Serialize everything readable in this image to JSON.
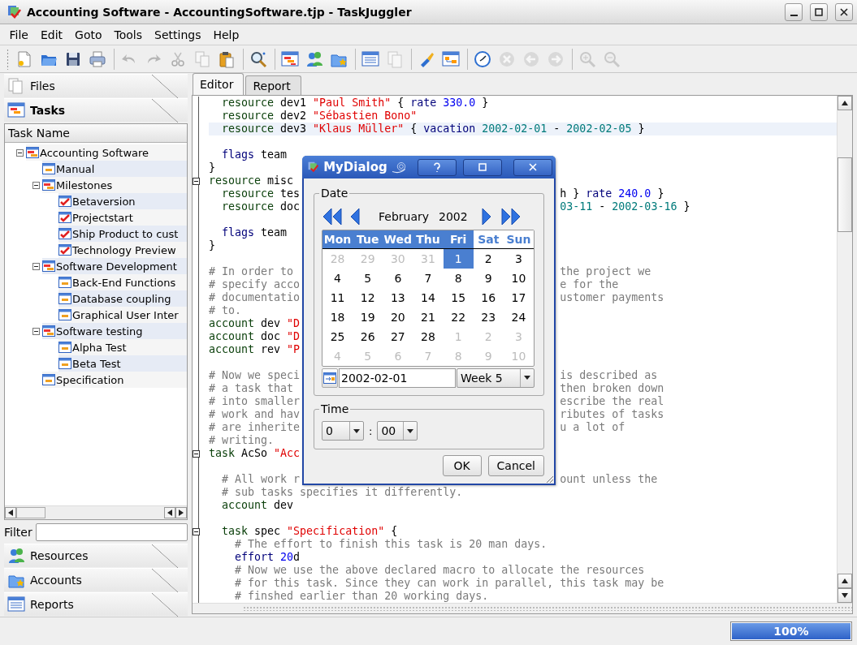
{
  "window": {
    "title": "Accounting Software - AccountingSoftware.tjp - TaskJuggler"
  },
  "menu": [
    "File",
    "Edit",
    "Goto",
    "Tools",
    "Settings",
    "Help"
  ],
  "toolbar": [
    [
      {
        "disabled": false
      },
      {
        "disabled": false
      },
      {
        "disabled": false
      },
      {
        "disabled": false
      }
    ],
    [
      {
        "disabled": true
      },
      {
        "disabled": true
      },
      {
        "disabled": true
      },
      {
        "disabled": true
      },
      {
        "disabled": false
      }
    ],
    [
      {
        "disabled": false
      }
    ],
    [
      {
        "disabled": false
      },
      {
        "disabled": false
      },
      {
        "disabled": false
      }
    ],
    [
      {
        "disabled": false
      },
      {
        "disabled": true
      }
    ],
    [
      {
        "disabled": false
      },
      {
        "disabled": false
      }
    ],
    [
      {
        "disabled": false
      },
      {
        "disabled": true
      },
      {
        "disabled": true
      },
      {
        "disabled": true
      }
    ],
    [
      {
        "disabled": true
      },
      {
        "disabled": true
      }
    ]
  ],
  "sidebar": {
    "sections": [
      {
        "label": "Files",
        "selected": false
      },
      {
        "label": "Tasks",
        "selected": true
      },
      {
        "label": "Resources",
        "selected": false
      },
      {
        "label": "Accounts",
        "selected": false
      },
      {
        "label": "Reports",
        "selected": false
      }
    ],
    "tree": {
      "column": "Task Name",
      "items": [
        {
          "label": "Accounting Software",
          "kind": "group",
          "expanded": true,
          "children": [
            {
              "label": "Manual",
              "kind": "task"
            },
            {
              "label": "Milestones",
              "kind": "group",
              "expanded": true,
              "children": [
                {
                  "label": "Betaversion",
                  "kind": "milestone"
                },
                {
                  "label": "Projectstart",
                  "kind": "milestone"
                },
                {
                  "label": "Ship Product to cust",
                  "kind": "milestone"
                },
                {
                  "label": "Technology Preview",
                  "kind": "milestone"
                }
              ]
            },
            {
              "label": "Software Development",
              "kind": "group",
              "expanded": true,
              "children": [
                {
                  "label": "Back-End Functions",
                  "kind": "task"
                },
                {
                  "label": "Database coupling",
                  "kind": "task"
                },
                {
                  "label": "Graphical User Inter",
                  "kind": "task"
                }
              ]
            },
            {
              "label": "Software testing",
              "kind": "group",
              "expanded": true,
              "children": [
                {
                  "label": "Alpha Test",
                  "kind": "task"
                },
                {
                  "label": "Beta Test",
                  "kind": "task"
                }
              ]
            },
            {
              "label": "Specification",
              "kind": "task"
            }
          ]
        }
      ]
    },
    "filter": {
      "label": "Filter"
    }
  },
  "editor": {
    "tabs": [
      {
        "label": "Editor",
        "selected": true
      },
      {
        "label": "Report",
        "selected": false
      }
    ],
    "lines": [
      {
        "kind": "code",
        "left": [
          {
            "kind": "kw",
            "text": "  resource"
          },
          {
            "kind": "p",
            "text": " dev1 "
          },
          {
            "kind": "s",
            "text": "\"Paul Smith\""
          },
          {
            "kind": "p",
            "text": " { "
          },
          {
            "kind": "k2",
            "text": "rate"
          },
          {
            "kind": "n",
            "text": " 330.0"
          },
          {
            "kind": "p",
            "text": " }"
          }
        ]
      },
      {
        "kind": "code",
        "left": [
          {
            "kind": "kw",
            "text": "  resource"
          },
          {
            "kind": "p",
            "text": " dev2 "
          },
          {
            "kind": "s",
            "text": "\"Sébastien Bono\""
          }
        ]
      },
      {
        "kind": "code",
        "current": true,
        "left": [
          {
            "kind": "kw",
            "text": "  resource"
          },
          {
            "kind": "p",
            "text": " dev3 "
          },
          {
            "kind": "s",
            "text": "\"Klaus Müller\""
          },
          {
            "kind": "p",
            "text": " { "
          },
          {
            "kind": "k2",
            "text": "vacation"
          },
          {
            "kind": "d",
            "text": " 2002-02-01"
          },
          {
            "kind": "p",
            "text": " - "
          },
          {
            "kind": "d",
            "text": "2002-02-05"
          },
          {
            "kind": "p",
            "text": " }"
          }
        ]
      },
      {
        "kind": "blank"
      },
      {
        "kind": "code",
        "left": [
          {
            "kind": "k2",
            "text": "  flags"
          },
          {
            "kind": "p",
            "text": " team"
          }
        ]
      },
      {
        "kind": "code",
        "left": [
          {
            "kind": "p",
            "text": "}"
          }
        ]
      },
      {
        "kind": "code",
        "fold": true,
        "left": [
          {
            "kind": "kw",
            "text": "resource"
          },
          {
            "kind": "p",
            "text": " misc"
          }
        ]
      },
      {
        "kind": "code",
        "left": [
          {
            "kind": "kw",
            "text": "  resource"
          },
          {
            "kind": "p",
            "text": " tes"
          }
        ],
        "right": [
          {
            "kind": "p",
            "text": "h } "
          },
          {
            "kind": "k2",
            "text": "rate"
          },
          {
            "kind": "n",
            "text": " 240.0"
          },
          {
            "kind": "p",
            "text": " }"
          }
        ]
      },
      {
        "kind": "code",
        "left": [
          {
            "kind": "kw",
            "text": "  resource"
          },
          {
            "kind": "p",
            "text": " doc"
          }
        ],
        "right": [
          {
            "kind": "d",
            "text": "03-11"
          },
          {
            "kind": "p",
            "text": " - "
          },
          {
            "kind": "d",
            "text": "2002-03-16"
          },
          {
            "kind": "p",
            "text": " }"
          }
        ]
      },
      {
        "kind": "blank"
      },
      {
        "kind": "code",
        "left": [
          {
            "kind": "k2",
            "text": "  flags"
          },
          {
            "kind": "p",
            "text": " team"
          }
        ]
      },
      {
        "kind": "code",
        "left": [
          {
            "kind": "p",
            "text": "}"
          }
        ]
      },
      {
        "kind": "blank"
      },
      {
        "kind": "code",
        "left": [
          {
            "kind": "c",
            "text": "# In order to"
          }
        ],
        "right": [
          {
            "kind": "c",
            "text": "the project we"
          }
        ]
      },
      {
        "kind": "code",
        "left": [
          {
            "kind": "c",
            "text": "# specify acco"
          }
        ],
        "right": [
          {
            "kind": "c",
            "text": "e for the"
          }
        ]
      },
      {
        "kind": "code",
        "left": [
          {
            "kind": "c",
            "text": "# documentatio"
          }
        ],
        "right": [
          {
            "kind": "c",
            "text": "ustomer payments"
          }
        ]
      },
      {
        "kind": "code",
        "left": [
          {
            "kind": "c",
            "text": "# to."
          }
        ]
      },
      {
        "kind": "code",
        "left": [
          {
            "kind": "kw",
            "text": "account"
          },
          {
            "kind": "p",
            "text": " dev "
          },
          {
            "kind": "s",
            "text": "\"D"
          }
        ]
      },
      {
        "kind": "code",
        "left": [
          {
            "kind": "kw",
            "text": "account"
          },
          {
            "kind": "p",
            "text": " doc "
          },
          {
            "kind": "s",
            "text": "\"D"
          }
        ]
      },
      {
        "kind": "code",
        "left": [
          {
            "kind": "kw",
            "text": "account"
          },
          {
            "kind": "p",
            "text": " rev "
          },
          {
            "kind": "s",
            "text": "\"P"
          }
        ]
      },
      {
        "kind": "blank"
      },
      {
        "kind": "code",
        "left": [
          {
            "kind": "c",
            "text": "# Now we speci"
          }
        ],
        "right": [
          {
            "kind": "c",
            "text": "is described as"
          }
        ]
      },
      {
        "kind": "code",
        "left": [
          {
            "kind": "c",
            "text": "# a task that"
          }
        ],
        "right": [
          {
            "kind": "c",
            "text": "then broken down"
          }
        ]
      },
      {
        "kind": "code",
        "left": [
          {
            "kind": "c",
            "text": "# into smaller"
          }
        ],
        "right": [
          {
            "kind": "c",
            "text": "escribe the real"
          }
        ]
      },
      {
        "kind": "code",
        "left": [
          {
            "kind": "c",
            "text": "# work and hav"
          }
        ],
        "right": [
          {
            "kind": "c",
            "text": "ributes of tasks"
          }
        ]
      },
      {
        "kind": "code",
        "left": [
          {
            "kind": "c",
            "text": "# are inherite"
          }
        ],
        "right": [
          {
            "kind": "c",
            "text": "u a lot of"
          }
        ]
      },
      {
        "kind": "code",
        "left": [
          {
            "kind": "c",
            "text": "# writing."
          }
        ]
      },
      {
        "kind": "code",
        "fold": true,
        "left": [
          {
            "kind": "kw",
            "text": "task"
          },
          {
            "kind": "p",
            "text": " AcSo "
          },
          {
            "kind": "s",
            "text": "\"Acc"
          }
        ]
      },
      {
        "kind": "blank"
      },
      {
        "kind": "code",
        "left": [
          {
            "kind": "c",
            "text": "  # All work r"
          }
        ],
        "right": [
          {
            "kind": "c",
            "text": "ount unless the"
          }
        ]
      },
      {
        "kind": "code",
        "left": [
          {
            "kind": "c",
            "text": "  # sub tasks specifies it differently."
          }
        ]
      },
      {
        "kind": "code",
        "left": [
          {
            "kind": "kw",
            "text": "  account"
          },
          {
            "kind": "p",
            "text": " dev"
          }
        ]
      },
      {
        "kind": "blank"
      },
      {
        "kind": "code",
        "fold": true,
        "left": [
          {
            "kind": "kw",
            "text": "  task"
          },
          {
            "kind": "p",
            "text": " spec "
          },
          {
            "kind": "s",
            "text": "\"Specification\""
          },
          {
            "kind": "p",
            "text": " {"
          }
        ]
      },
      {
        "kind": "code",
        "left": [
          {
            "kind": "c",
            "text": "    # The effort to finish this task is 20 man days."
          }
        ]
      },
      {
        "kind": "code",
        "left": [
          {
            "kind": "k2",
            "text": "    effort"
          },
          {
            "kind": "n",
            "text": " 20"
          },
          {
            "kind": "p",
            "text": "d"
          }
        ]
      },
      {
        "kind": "code",
        "left": [
          {
            "kind": "c",
            "text": "    # Now we use the above declared macro to allocate the resources"
          }
        ]
      },
      {
        "kind": "code",
        "left": [
          {
            "kind": "c",
            "text": "    # for this task. Since they can work in parallel, this task may be"
          }
        ]
      },
      {
        "kind": "code",
        "left": [
          {
            "kind": "c",
            "text": "    # finshed earlier than 20 working days."
          }
        ]
      }
    ]
  },
  "dialog": {
    "title": "MyDialog",
    "date_group": {
      "label": "Date",
      "month": "February",
      "year": "2002",
      "weekdays": [
        {
          "label": "Mon",
          "weekend": false
        },
        {
          "label": "Tue",
          "weekend": false
        },
        {
          "label": "Wed",
          "weekend": false
        },
        {
          "label": "Thu",
          "weekend": false
        },
        {
          "label": "Fri",
          "weekend": false
        },
        {
          "label": "Sat",
          "weekend": true
        },
        {
          "label": "Sun",
          "weekend": true
        }
      ],
      "weeks": [
        [
          {
            "day": "28",
            "outside": true,
            "selected": false
          },
          {
            "day": "29",
            "outside": true,
            "selected": false
          },
          {
            "day": "30",
            "outside": true,
            "selected": false
          },
          {
            "day": "31",
            "outside": true,
            "selected": false
          },
          {
            "day": "1",
            "outside": false,
            "selected": true
          },
          {
            "day": "2",
            "outside": false,
            "selected": false
          },
          {
            "day": "3",
            "outside": false,
            "selected": false
          }
        ],
        [
          {
            "day": "4",
            "outside": false,
            "selected": false
          },
          {
            "day": "5",
            "outside": false,
            "selected": false
          },
          {
            "day": "6",
            "outside": false,
            "selected": false
          },
          {
            "day": "7",
            "outside": false,
            "selected": false
          },
          {
            "day": "8",
            "outside": false,
            "selected": false
          },
          {
            "day": "9",
            "outside": false,
            "selected": false
          },
          {
            "day": "10",
            "outside": false,
            "selected": false
          }
        ],
        [
          {
            "day": "11",
            "outside": false,
            "selected": false
          },
          {
            "day": "12",
            "outside": false,
            "selected": false
          },
          {
            "day": "13",
            "outside": false,
            "selected": false
          },
          {
            "day": "14",
            "outside": false,
            "selected": false
          },
          {
            "day": "15",
            "outside": false,
            "selected": false
          },
          {
            "day": "16",
            "outside": false,
            "selected": false
          },
          {
            "day": "17",
            "outside": false,
            "selected": false
          }
        ],
        [
          {
            "day": "18",
            "outside": false,
            "selected": false
          },
          {
            "day": "19",
            "outside": false,
            "selected": false
          },
          {
            "day": "20",
            "outside": false,
            "selected": false
          },
          {
            "day": "21",
            "outside": false,
            "selected": false
          },
          {
            "day": "22",
            "outside": false,
            "selected": false
          },
          {
            "day": "23",
            "outside": false,
            "selected": false
          },
          {
            "day": "24",
            "outside": false,
            "selected": false
          }
        ],
        [
          {
            "day": "25",
            "outside": false,
            "selected": false
          },
          {
            "day": "26",
            "outside": false,
            "selected": false
          },
          {
            "day": "27",
            "outside": false,
            "selected": false
          },
          {
            "day": "28",
            "outside": false,
            "selected": false
          },
          {
            "day": "1",
            "outside": true,
            "selected": false
          },
          {
            "day": "2",
            "outside": true,
            "selected": false
          },
          {
            "day": "3",
            "outside": true,
            "selected": false
          }
        ],
        [
          {
            "day": "4",
            "outside": true,
            "selected": false
          },
          {
            "day": "5",
            "outside": true,
            "selected": false
          },
          {
            "day": "6",
            "outside": true,
            "selected": false
          },
          {
            "day": "7",
            "outside": true,
            "selected": false
          },
          {
            "day": "8",
            "outside": true,
            "selected": false
          },
          {
            "day": "9",
            "outside": true,
            "selected": false
          },
          {
            "day": "10",
            "outside": true,
            "selected": false
          }
        ]
      ],
      "date_field": {
        "value": "2002-02-01"
      },
      "week_combo": "Week 5"
    },
    "time_group": {
      "label": "Time",
      "hour": "0",
      "separator": ":",
      "minute": "00"
    },
    "buttons": [
      "OK",
      "Cancel"
    ]
  },
  "status_bar": {
    "progress": {
      "level": 1,
      "text": "100%"
    }
  }
}
